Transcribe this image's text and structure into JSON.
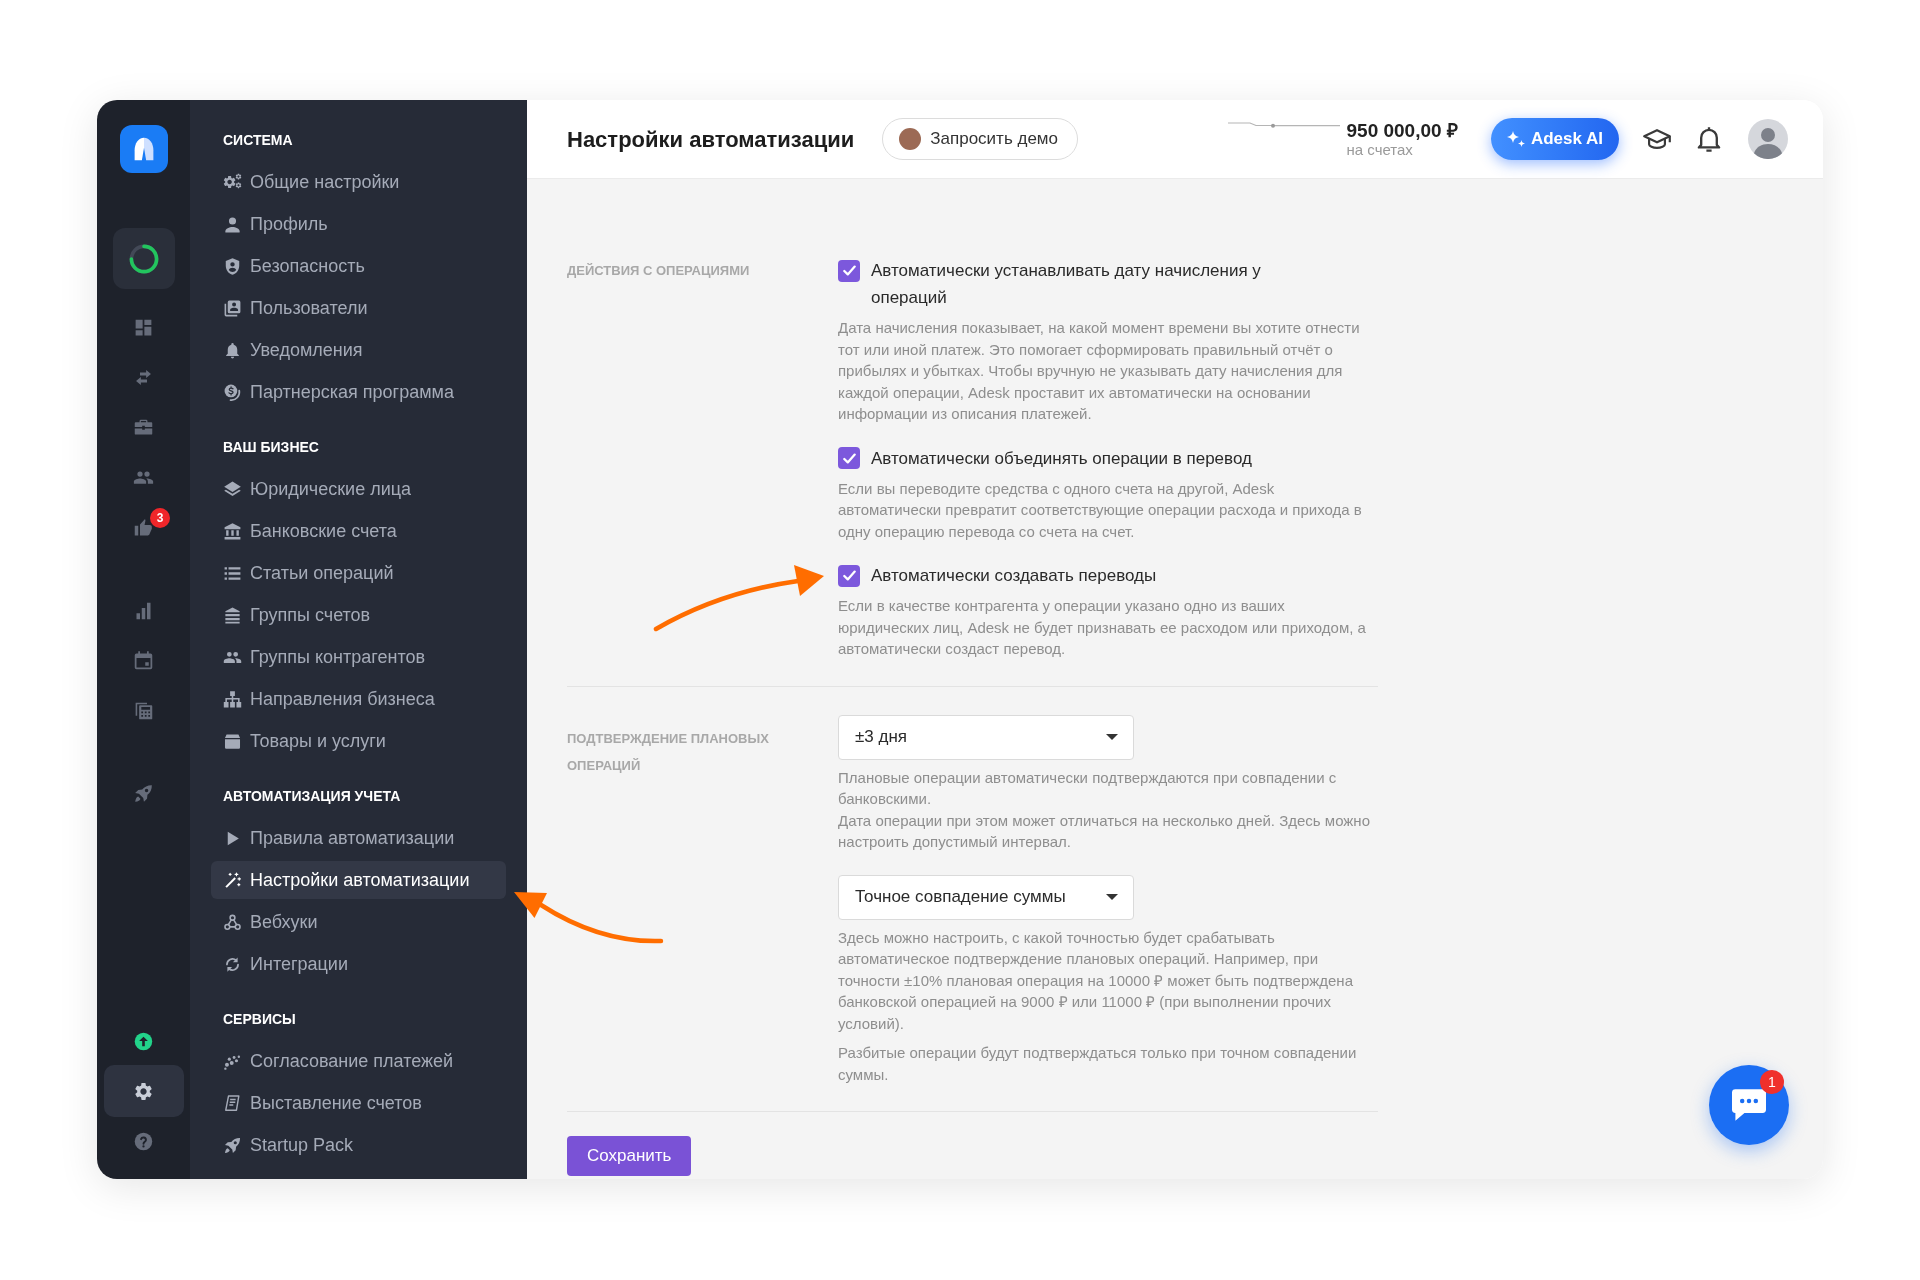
{
  "rail": {
    "items": [
      {
        "selected": false
      },
      {
        "selected": false
      },
      {
        "selected": false
      },
      {
        "selected": false
      },
      {
        "selected": false,
        "badge": "3"
      },
      {
        "selected": false
      },
      {
        "selected": false
      },
      {
        "selected": false
      },
      {
        "selected": false
      }
    ],
    "bottom_items": [
      {
        "selected": false
      },
      {
        "selected": true
      },
      {
        "selected": false
      }
    ]
  },
  "sidebar": {
    "sections": [
      {
        "title": "СИСТЕМА",
        "items": [
          {
            "label": "Общие настройки",
            "selected": false
          },
          {
            "label": "Профиль",
            "selected": false
          },
          {
            "label": "Безопасность",
            "selected": false
          },
          {
            "label": "Пользователи",
            "selected": false
          },
          {
            "label": "Уведомления",
            "selected": false
          },
          {
            "label": "Партнерская программа",
            "selected": false
          }
        ]
      },
      {
        "title": "ВАШ БИЗНЕС",
        "items": [
          {
            "label": "Юридические лица",
            "selected": false
          },
          {
            "label": "Банковские счета",
            "selected": false
          },
          {
            "label": "Статьи операций",
            "selected": false
          },
          {
            "label": "Группы счетов",
            "selected": false
          },
          {
            "label": "Группы контрагентов",
            "selected": false
          },
          {
            "label": "Направления бизнеса",
            "selected": false
          },
          {
            "label": "Товары и услуги",
            "selected": false
          }
        ]
      },
      {
        "title": "АВТОМАТИЗАЦИЯ УЧЕТА",
        "items": [
          {
            "label": "Правила автоматизации",
            "selected": false
          },
          {
            "label": "Настройки автоматизации",
            "selected": true
          },
          {
            "label": "Вебхуки",
            "selected": false
          },
          {
            "label": "Интеграции",
            "selected": false
          }
        ]
      },
      {
        "title": "СЕРВИСЫ",
        "items": [
          {
            "label": "Согласование платежей",
            "selected": false
          },
          {
            "label": "Выставление счетов",
            "selected": false
          },
          {
            "label": "Startup Pack",
            "selected": false
          }
        ]
      }
    ]
  },
  "header": {
    "title": "Настройки автоматизации",
    "demo_button": "Запросить демо",
    "balance": {
      "amount": "950 000,00 ₽",
      "caption": "на счетах"
    },
    "ai_button": "Adesk AI"
  },
  "settings": {
    "sections": [
      {
        "label": "ДЕЙСТВИЯ С ОПЕРАЦИЯМИ",
        "kind": "checkboxes",
        "options": [
          {
            "label": "Автоматически устанавливать дату начисления у операций",
            "checked": true,
            "description": "Дата начисления показывает, на какой момент времени вы хотите отнести тот или иной платеж. Это помогает сформировать правильный отчёт о прибылях и убытках. Чтобы вручную не указывать дату начисления для каждой операции, Adesk проставит их автоматически на основании информации из описания платежей."
          },
          {
            "label": "Автоматически объединять операции в перевод",
            "checked": true,
            "description": "Если вы переводите средства с одного счета на другой, Adesk автоматически превратит соответствующие операции расхода и прихода в одну операцию перевода со счета на счет."
          },
          {
            "label": "Автоматически создавать переводы",
            "checked": true,
            "description": "Если в качестве контрагента у операции указано одно из ваших юридических лиц, Adesk не будет признавать ее расходом или приходом, а автоматически создаст перевод."
          }
        ]
      },
      {
        "label": "ПОДТВЕРЖДЕНИЕ ПЛАНОВЫХ ОПЕРАЦИЙ",
        "kind": "selects",
        "selects": [
          {
            "value": "±3 дня",
            "notes": [
              "Плановые операции автоматически подтверждаются при совпадении с банковскими.\nДата операции при этом может отличаться на несколько дней. Здесь можно настроить допустимый интервал."
            ]
          },
          {
            "value": "Точное совпадение суммы",
            "notes": [
              "Здесь можно настроить, с какой точностью будет срабатывать автоматическое подтверждение плановых операций. Например, при точности ±10% плановая операция на 10000 ₽ может быть подтверждена банковской операцией на 9000 ₽ или 11000 ₽ (при выполнении прочих условий).",
              "Разбитые операции будут подтверждаться только при точном совпадении суммы."
            ]
          }
        ]
      }
    ],
    "save_button": "Сохранить"
  },
  "chat": {
    "badge": "1"
  }
}
